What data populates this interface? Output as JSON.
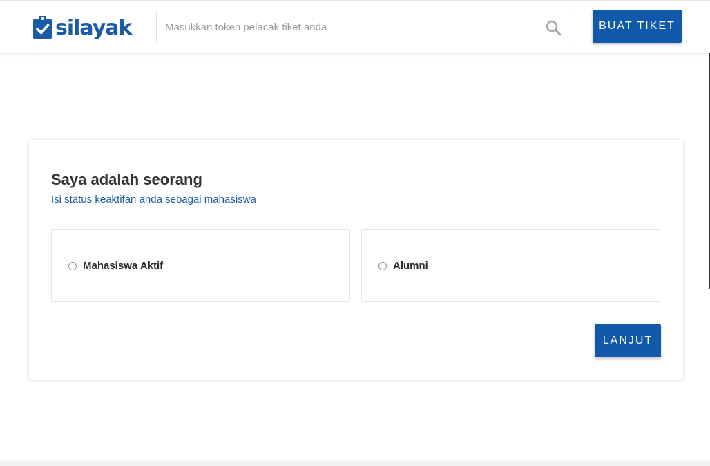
{
  "header": {
    "logo_text": "silayak",
    "search": {
      "placeholder": "Masukkan token pelacak tiket anda",
      "value": ""
    },
    "create_ticket_label": "BUAT TIKET"
  },
  "form": {
    "title": "Saya adalah seorang",
    "subtitle": "Isi status keaktifan anda sebagai mahasiswa",
    "options": [
      {
        "label": "Mahasiswa Aktif",
        "selected": false
      },
      {
        "label": "Alumni",
        "selected": false
      }
    ],
    "next_label": "LANJUT"
  },
  "colors": {
    "brand": "#1a5ba6",
    "button": "#1059ab",
    "subtitle": "#1a5ba6"
  },
  "icons": {
    "logo": "clipboard-check-icon",
    "search": "search-icon",
    "radio": "radio-unchecked-icon"
  }
}
